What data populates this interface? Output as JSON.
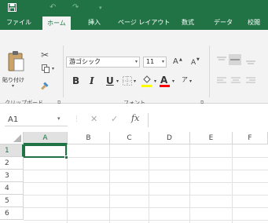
{
  "colors": {
    "accent": "#217346",
    "ribbon_bg": "#f3f3f3"
  },
  "quick_access": {
    "save_icon": "save-icon",
    "undo_icon": "undo-icon",
    "redo_icon": "redo-icon",
    "customize_icon": "customize-icon"
  },
  "ribbon_tabs": [
    {
      "label": "ファイル",
      "active": false
    },
    {
      "label": "ホーム",
      "active": true
    },
    {
      "label": "挿入",
      "active": false
    },
    {
      "label": "ページ レイアウト",
      "active": false
    },
    {
      "label": "数式",
      "active": false
    },
    {
      "label": "データ",
      "active": false
    },
    {
      "label": "校閲",
      "active": false
    }
  ],
  "clipboard": {
    "paste_label": "貼り付け",
    "group_label": "クリップボード"
  },
  "font": {
    "font_name": "游ゴシック",
    "font_size": "11",
    "grow_glyph": "A",
    "shrink_glyph": "A",
    "bold": "B",
    "italic": "I",
    "underline": "U",
    "font_color_glyph": "A",
    "phonetic_glyph": "ア",
    "group_label": "フォント",
    "highlight_color": "#ffff00",
    "font_color": "#ff0000"
  },
  "formula_bar": {
    "name_box": "A1",
    "cancel": "✕",
    "enter": "✓",
    "fx": "fx"
  },
  "grid": {
    "columns": [
      "A",
      "B",
      "C",
      "D",
      "E",
      "F"
    ],
    "rows": [
      "1",
      "2",
      "3",
      "4",
      "5",
      "6"
    ],
    "selected_cell": "A1"
  }
}
